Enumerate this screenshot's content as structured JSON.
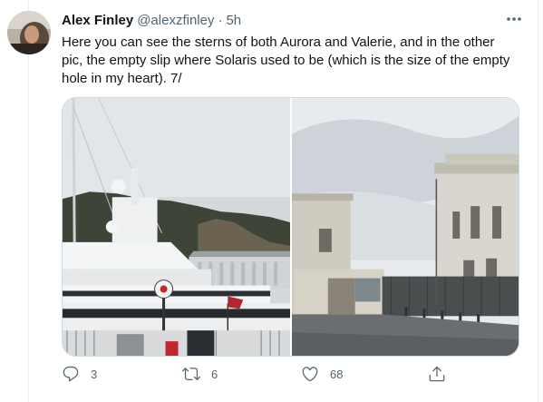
{
  "tweet": {
    "author_name": "Alex Finley",
    "handle": "@alexzfinley",
    "separator": "·",
    "time": "5h",
    "text": "Here you can see the sterns of both Aurora and Valerie, and in the other pic, the empty slip where Solaris used to be (which is the size of the empty hole in my heart). 7/"
  },
  "media": {
    "left_photo": "yachts-in-harbor-photo",
    "right_photo": "empty-slip-dock-photo"
  },
  "actions": {
    "reply_count": "3",
    "retweet_count": "6",
    "like_count": "68"
  },
  "colors": {
    "text": "#0f1419",
    "secondary": "#536471",
    "border": "#cfd9de"
  }
}
